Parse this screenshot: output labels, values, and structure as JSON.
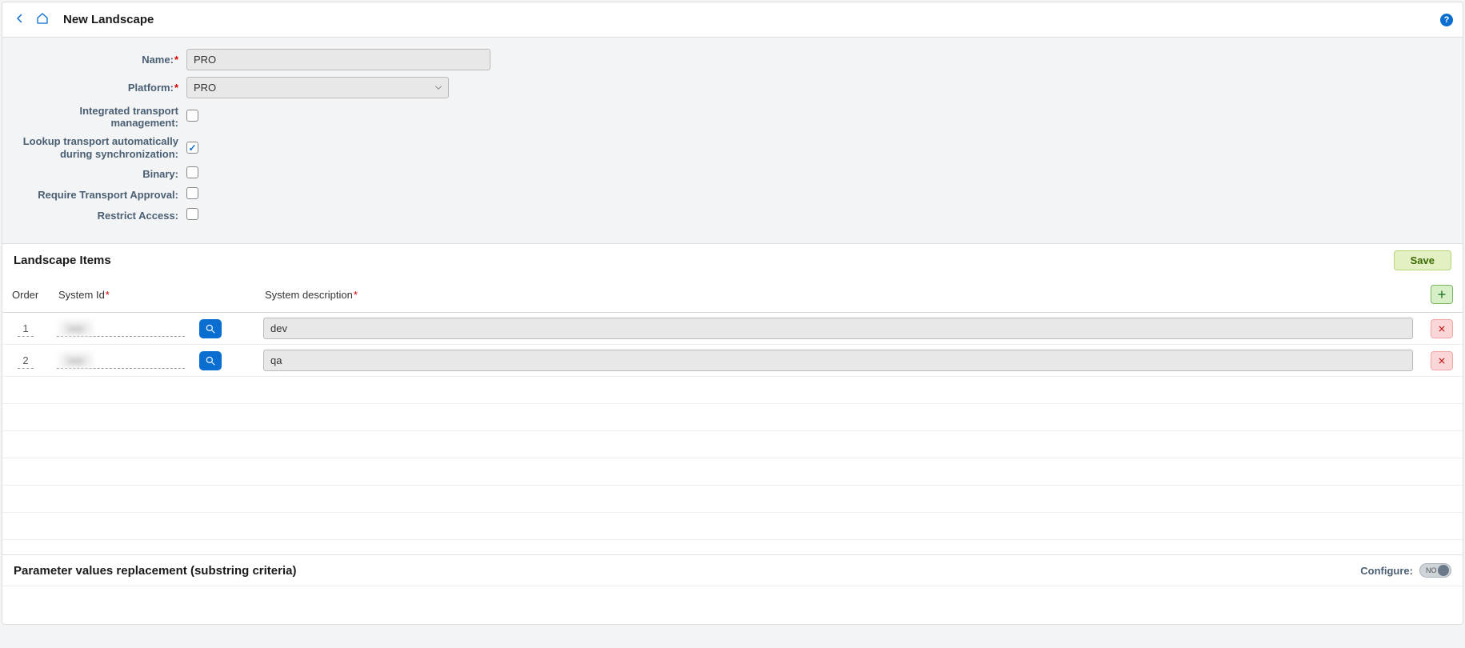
{
  "header": {
    "title": "New Landscape"
  },
  "form": {
    "labels": {
      "name": "Name:",
      "platform": "Platform:",
      "itm": "Integrated transport management:",
      "lookup_line1": "Lookup transport automatically",
      "lookup_line2": "during synchronization:",
      "binary": "Binary:",
      "approval": "Require Transport Approval:",
      "restrict": "Restrict Access:"
    },
    "values": {
      "name": "PRO",
      "platform": "PRO"
    }
  },
  "landscape_items": {
    "title": "Landscape Items",
    "save_label": "Save",
    "columns": {
      "order": "Order",
      "system_id": "System Id",
      "desc": "System description"
    },
    "rows": [
      {
        "order": "1",
        "system_id": "",
        "desc": "dev"
      },
      {
        "order": "2",
        "system_id": "",
        "desc": "qa"
      }
    ]
  },
  "params": {
    "title": "Parameter values replacement (substring criteria)",
    "configure_label": "Configure:",
    "toggle_text": "NO"
  }
}
